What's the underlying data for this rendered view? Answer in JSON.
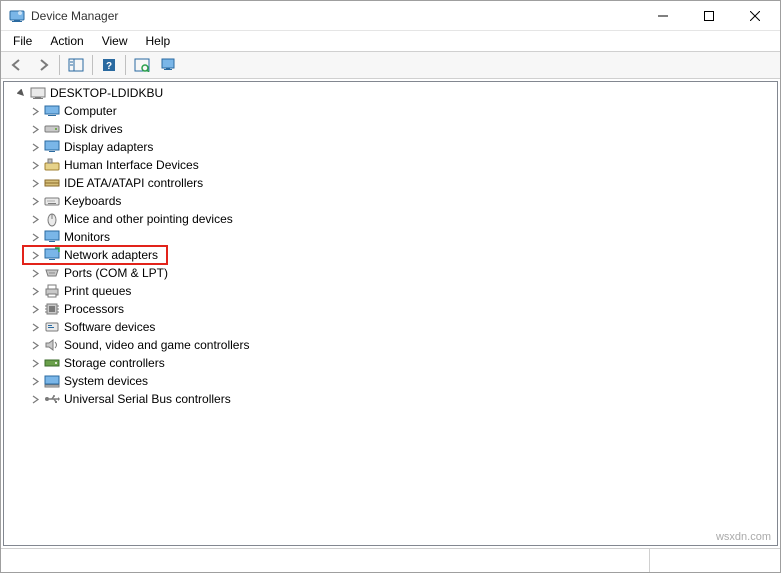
{
  "window": {
    "title": "Device Manager"
  },
  "menu": {
    "file": "File",
    "action": "Action",
    "view": "View",
    "help": "Help"
  },
  "tree": {
    "root": "DESKTOP-LDIDKBU",
    "items": [
      "Computer",
      "Disk drives",
      "Display adapters",
      "Human Interface Devices",
      "IDE ATA/ATAPI controllers",
      "Keyboards",
      "Mice and other pointing devices",
      "Monitors",
      "Network adapters",
      "Ports (COM & LPT)",
      "Print queues",
      "Processors",
      "Software devices",
      "Sound, video and game controllers",
      "Storage controllers",
      "System devices",
      "Universal Serial Bus controllers"
    ],
    "highlighted_index": 8
  },
  "watermark": "wsxdn.com"
}
